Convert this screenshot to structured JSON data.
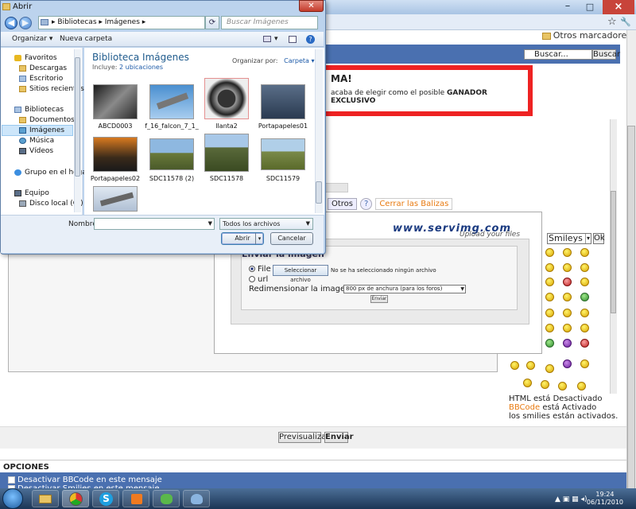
{
  "browser": {
    "bookmarks_label": "Otros marcadores",
    "search_placeholder": "Buscar...",
    "search_button": "Buscar",
    "close_glyph": "×",
    "min_glyph": "–",
    "max_glyph": "□",
    "star_glyph": "☆",
    "wrench_glyph": "🔧"
  },
  "banner": {
    "headline": "MA!",
    "text_prefix": "acaba de elegir como el posible ",
    "text_bold": "GANADOR EXCLUSIVO"
  },
  "editor_tabs": {
    "otros": "Otros",
    "help_glyph": "?",
    "cerrar_balizas": "Cerrar las Balizas"
  },
  "upload": {
    "logo": "www.servimg.com",
    "logo_sub": "Upload your files",
    "title": "Enviar la imagen",
    "file_label": "File",
    "select_button": "Seleccionar archivo",
    "no_file": "No se ha seleccionado ningún archivo",
    "url_label": "url",
    "resize_label": "Redimensionar la imagen",
    "resize_value": "800 px de anchura (para los foros)",
    "send_button": "Enviar"
  },
  "smileys": {
    "select_label": "Smileys",
    "ok_label": "Ok"
  },
  "status": {
    "html_line": "HTML está Desactivado",
    "bbcode_link": "BBCode",
    "bbcode_rest": " está Activado",
    "smilies_line": "los smilies están activados."
  },
  "form": {
    "preview_button": "Previsualizar",
    "send_button": "Enviar",
    "options_title": "OPCIONES",
    "opt1": "Desactivar BBCode en este mensaje",
    "opt2": "Desactivar Smilies en este mensaje"
  },
  "taskbar": {
    "time": "19:24",
    "date": "06/11/2010"
  },
  "dialog": {
    "title": "Abrir",
    "close_glyph": "✕",
    "back_glyph": "◀",
    "forward_glyph": "▶",
    "breadcrumb": [
      "Bibliotecas",
      "Imágenes"
    ],
    "search_placeholder": "Buscar Imágenes",
    "organize": "Organizar",
    "new_folder": "Nueva carpeta",
    "nav": {
      "favorites": "Favoritos",
      "downloads": "Descargas",
      "desktop": "Escritorio",
      "recent": "Sitios recientes",
      "libraries": "Bibliotecas",
      "documents": "Documentos",
      "images": "Imágenes",
      "music": "Música",
      "videos": "Vídeos",
      "homegroup": "Grupo en el hogar",
      "computer": "Equipo",
      "local_disk": "Disco local (C:)"
    },
    "library_title": "Biblioteca Imágenes",
    "includes": "Incluye:",
    "locations": "2 ubicaciones",
    "arrange_by": "Organizar por:",
    "arrange_value": "Carpeta",
    "files": [
      {
        "name": "ABCD0003"
      },
      {
        "name": "f_16_falcon_7_1_"
      },
      {
        "name": "llanta2"
      },
      {
        "name": "Portapapeles01"
      },
      {
        "name": "Portapapeles02"
      },
      {
        "name": "SDC11578 (2)"
      },
      {
        "name": "SDC11578"
      },
      {
        "name": "SDC11579"
      },
      {
        "name": ""
      }
    ],
    "filename_label": "Nombre:",
    "filename_value": "",
    "filetype": "Todos los archivos",
    "open_button": "Abrir",
    "cancel_button": "Cancelar"
  }
}
